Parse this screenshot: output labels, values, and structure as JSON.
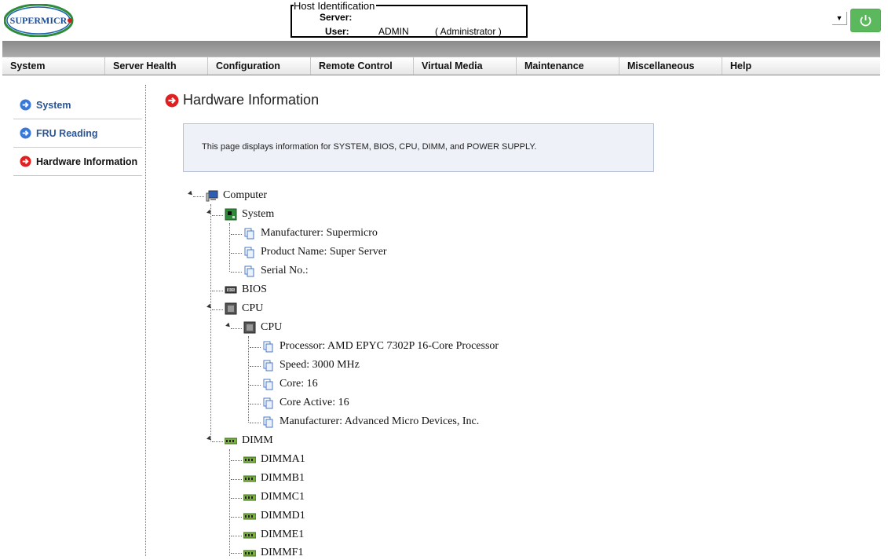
{
  "header": {
    "logo_text": "SUPERMICRO",
    "host_legend": "Host Identification",
    "server_label": "Server:",
    "server_value": "",
    "user_label": "User:",
    "user_value": "ADMIN",
    "user_role": "( Administrator )",
    "dropdown_arrow": "▼"
  },
  "menu": [
    "System",
    "Server Health",
    "Configuration",
    "Remote Control",
    "Virtual Media",
    "Maintenance",
    "Miscellaneous",
    "Help"
  ],
  "sidebar": [
    {
      "label": "System",
      "active": false
    },
    {
      "label": "FRU Reading",
      "active": false
    },
    {
      "label": "Hardware Information",
      "active": true
    }
  ],
  "page": {
    "title": "Hardware Information",
    "info_text": "This page displays information for SYSTEM, BIOS, CPU, DIMM, and POWER SUPPLY."
  },
  "tree": {
    "computer": "Computer",
    "system": "System",
    "system_manufacturer": "Manufacturer: Supermicro",
    "system_product": "Product Name: Super Server",
    "system_serial": "Serial No.:",
    "bios": "BIOS",
    "cpu_group": "CPU",
    "cpu": "CPU",
    "cpu_processor": "Processor: AMD EPYC 7302P 16-Core Processor",
    "cpu_speed": "Speed: 3000 MHz",
    "cpu_core": "Core: 16",
    "cpu_core_active": "Core Active: 16",
    "cpu_manufacturer": "Manufacturer: Advanced Micro Devices, Inc.",
    "dimm": "DIMM",
    "dimms": [
      "DIMMA1",
      "DIMMB1",
      "DIMMC1",
      "DIMMD1",
      "DIMME1",
      "DIMMF1"
    ]
  },
  "colors": {
    "accent_blue": "#2a5597",
    "active_red": "#e02020",
    "power_green": "#5cb85c"
  }
}
